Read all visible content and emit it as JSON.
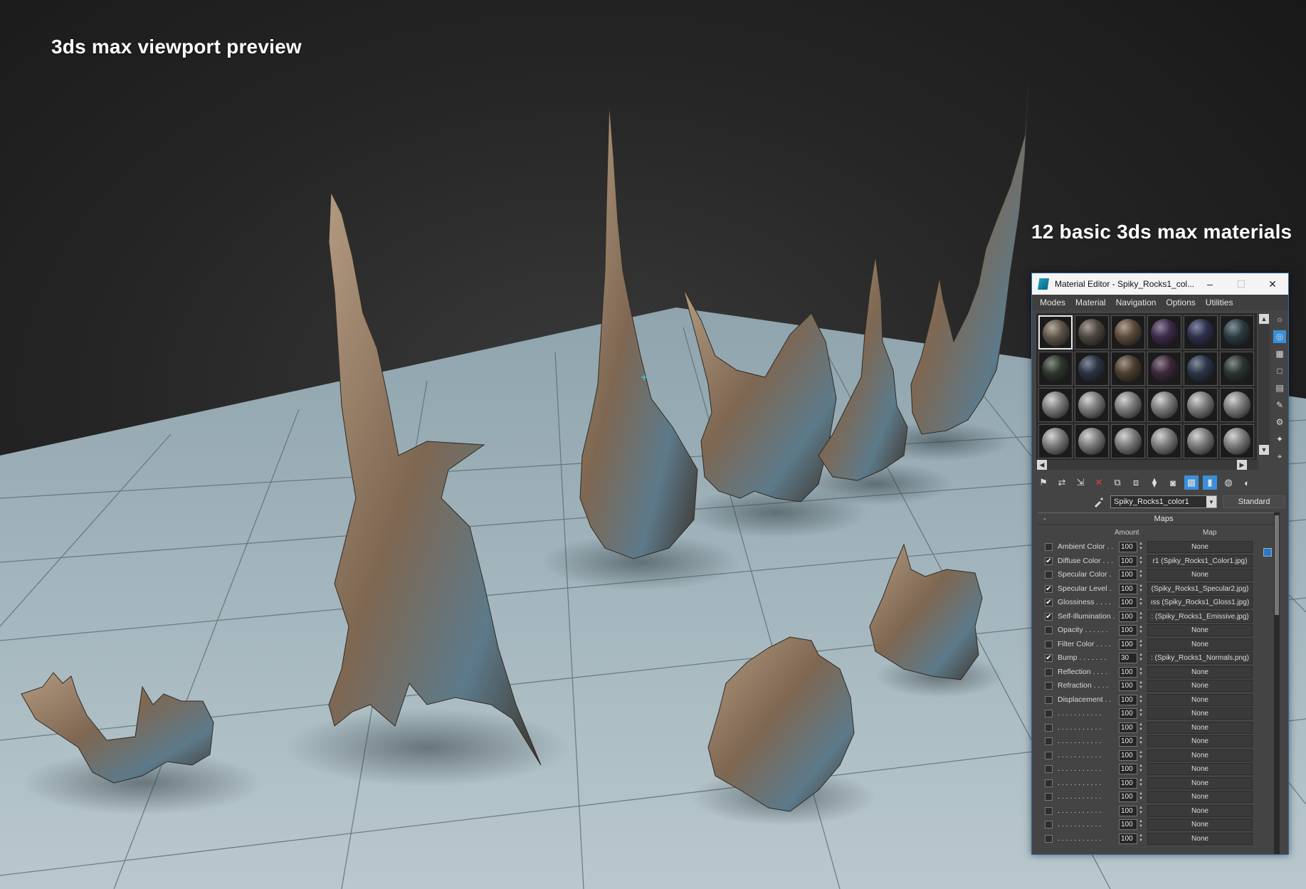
{
  "captions": {
    "viewport": "3ds max viewport preview",
    "materials": "12 basic 3ds max materials"
  },
  "colors": {
    "floor": "#a8bcc4",
    "rock_light": "#a8927a",
    "rock_mid": "#7a6550",
    "rock_dark": "#3d342c",
    "rock_blue": "#5c7f93",
    "background_top": "#161616",
    "selection_blue": "#3a8fd8"
  },
  "material_editor": {
    "title": "Material Editor - Spiky_Rocks1_col...",
    "window_buttons": {
      "minimize": "–",
      "maximize": "☐",
      "close": "✕"
    },
    "menu": [
      "Modes",
      "Material",
      "Navigation",
      "Options",
      "Utilities"
    ],
    "slots": {
      "rows": [
        [
          "#5c5248",
          "#4d4640",
          "#5a4a3a",
          "#3b2a48",
          "#2e2f4a",
          "#2a3a40"
        ],
        [
          "#2e352c",
          "#2a3242",
          "#4a3e30",
          "#3a2838",
          "#2a3548",
          "#2b3432"
        ],
        [
          "#7a7a7a",
          "#7a7a7a",
          "#7a7a7a",
          "#7a7a7a",
          "#7a7a7a",
          "#7a7a7a"
        ],
        [
          "#7a7a7a",
          "#7a7a7a",
          "#7a7a7a",
          "#7a7a7a",
          "#7a7a7a",
          "#7a7a7a"
        ]
      ]
    },
    "right_tool_icons": [
      "sample-type-icon",
      "backlight-icon",
      "background-icon",
      "sample-uv-icon",
      "video-check-icon",
      "make-preview-icon",
      "options-icon",
      "select-by-material-icon",
      "material-navigator-icon"
    ],
    "bottom_tool_icons": [
      "get-material-icon",
      "put-to-scene-icon",
      "assign-to-selection-icon",
      "reset-icon",
      "make-copy-icon",
      "make-unique-icon",
      "put-to-library-icon",
      "material-id-icon",
      "show-shaded-icon",
      "show-end-result-icon",
      "go-to-parent-icon",
      "go-forward-icon"
    ],
    "material_name": "Spiky_Rocks1_color1",
    "material_type": "Standard",
    "maps_rollout": {
      "title": "Maps",
      "collapse": "-",
      "amount_header": "Amount",
      "map_header": "Map",
      "rows": [
        {
          "checked": false,
          "label": "Ambient Color . .",
          "amount": "100",
          "map": "None"
        },
        {
          "checked": true,
          "label": "Diffuse Color . . .",
          "amount": "100",
          "map": "r1 (Spiky_Rocks1_Color1.jpg)"
        },
        {
          "checked": false,
          "label": "Specular Color .",
          "amount": "100",
          "map": "None"
        },
        {
          "checked": true,
          "label": "Specular Level .",
          "amount": "100",
          "map": "(Spiky_Rocks1_Specular2.jpg)"
        },
        {
          "checked": true,
          "label": "Glossiness . . . .",
          "amount": "100",
          "map": "ıss (Spiky_Rocks1_Gloss1.jpg)"
        },
        {
          "checked": true,
          "label": "Self-Illumination .",
          "amount": "100",
          "map": ": (Spiky_Rocks1_Emissive.jpg)"
        },
        {
          "checked": false,
          "label": "Opacity . . . . . .",
          "amount": "100",
          "map": "None"
        },
        {
          "checked": false,
          "label": "Filter Color . . . .",
          "amount": "100",
          "map": "None"
        },
        {
          "checked": true,
          "label": "Bump . . . . . . .",
          "amount": "30",
          "map": ": (Spiky_Rocks1_Normals.png)"
        },
        {
          "checked": false,
          "label": "Reflection . . . .",
          "amount": "100",
          "map": "None"
        },
        {
          "checked": false,
          "label": "Refraction . . . .",
          "amount": "100",
          "map": "None"
        },
        {
          "checked": false,
          "label": "Displacement . .",
          "amount": "100",
          "map": "None"
        },
        {
          "checked": false,
          "label": ". . . . . . . . . . .",
          "amount": "100",
          "map": "None"
        },
        {
          "checked": false,
          "label": ". . . . . . . . . . .",
          "amount": "100",
          "map": "None"
        },
        {
          "checked": false,
          "label": ". . . . . . . . . . .",
          "amount": "100",
          "map": "None"
        },
        {
          "checked": false,
          "label": ". . . . . . . . . . .",
          "amount": "100",
          "map": "None"
        },
        {
          "checked": false,
          "label": ". . . . . . . . . . .",
          "amount": "100",
          "map": "None"
        },
        {
          "checked": false,
          "label": ". . . . . . . . . . .",
          "amount": "100",
          "map": "None"
        },
        {
          "checked": false,
          "label": ". . . . . . . . . . .",
          "amount": "100",
          "map": "None"
        },
        {
          "checked": false,
          "label": ". . . . . . . . . . .",
          "amount": "100",
          "map": "None"
        },
        {
          "checked": false,
          "label": ". . . . . . . . . . .",
          "amount": "100",
          "map": "None"
        },
        {
          "checked": false,
          "label": ". . . . . . . . . . .",
          "amount": "100",
          "map": "None"
        }
      ]
    }
  }
}
